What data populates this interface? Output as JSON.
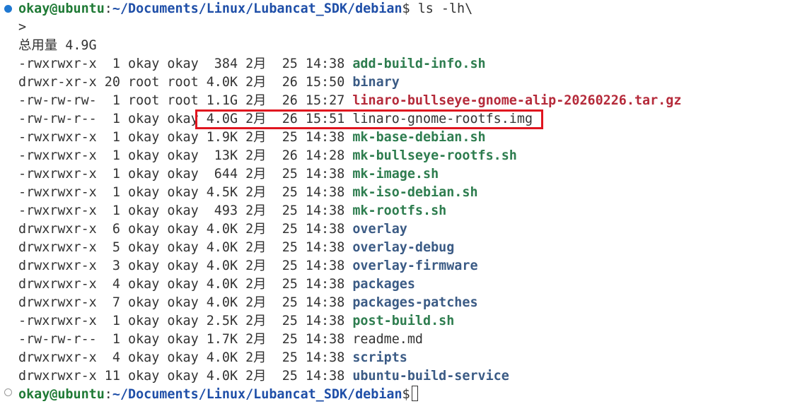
{
  "prompt": {
    "user_host": "okay@ubuntu",
    "colon": ":",
    "path": "~/Documents/Linux/Lubancat_SDK/debian",
    "symbol": "$",
    "command": " ls -lh\\"
  },
  "continuation": ">",
  "total_line": "总用量 4.9G",
  "listing": [
    {
      "meta": "-rwxrwxr-x  1 okay okay  384 2月  25 14:38 ",
      "name": "add-build-info.sh",
      "kind": "exec"
    },
    {
      "meta": "drwxr-xr-x 20 root root 4.0K 2月  26 15:50 ",
      "name": "binary",
      "kind": "dir"
    },
    {
      "meta": "-rw-rw-rw-  1 root root 1.1G 2月  26 15:27 ",
      "name": "linaro-bullseye-gnome-alip-20260226.tar.gz",
      "kind": "arch"
    },
    {
      "meta": "-rw-rw-r--  1 okay okay 4.0G 2月  26 15:51 ",
      "name": "linaro-gnome-rootfs.img",
      "kind": "plain"
    },
    {
      "meta": "-rwxrwxr-x  1 okay okay 1.9K 2月  25 14:38 ",
      "name": "mk-base-debian.sh",
      "kind": "exec"
    },
    {
      "meta": "-rwxrwxr-x  1 okay okay  13K 2月  26 14:28 ",
      "name": "mk-bullseye-rootfs.sh",
      "kind": "exec"
    },
    {
      "meta": "-rwxrwxr-x  1 okay okay  644 2月  25 14:38 ",
      "name": "mk-image.sh",
      "kind": "exec"
    },
    {
      "meta": "-rwxrwxr-x  1 okay okay 4.5K 2月  25 14:38 ",
      "name": "mk-iso-debian.sh",
      "kind": "exec"
    },
    {
      "meta": "-rwxrwxr-x  1 okay okay  493 2月  25 14:38 ",
      "name": "mk-rootfs.sh",
      "kind": "exec"
    },
    {
      "meta": "drwxrwxr-x  6 okay okay 4.0K 2月  25 14:38 ",
      "name": "overlay",
      "kind": "dir"
    },
    {
      "meta": "drwxrwxr-x  5 okay okay 4.0K 2月  25 14:38 ",
      "name": "overlay-debug",
      "kind": "dir"
    },
    {
      "meta": "drwxrwxr-x  3 okay okay 4.0K 2月  25 14:38 ",
      "name": "overlay-firmware",
      "kind": "dir"
    },
    {
      "meta": "drwxrwxr-x  4 okay okay 4.0K 2月  25 14:38 ",
      "name": "packages",
      "kind": "dir"
    },
    {
      "meta": "drwxrwxr-x  7 okay okay 4.0K 2月  25 14:38 ",
      "name": "packages-patches",
      "kind": "dir"
    },
    {
      "meta": "-rwxrwxr-x  1 okay okay 2.5K 2月  25 14:38 ",
      "name": "post-build.sh",
      "kind": "exec"
    },
    {
      "meta": "-rw-rw-r--  1 okay okay 1.7K 2月  25 14:38 ",
      "name": "readme.md",
      "kind": "plain"
    },
    {
      "meta": "drwxrwxr-x  4 okay okay 4.0K 2月  25 14:38 ",
      "name": "scripts",
      "kind": "dir"
    },
    {
      "meta": "drwxrwxr-x 11 okay okay 4.0K 2月  25 14:38 ",
      "name": "ubuntu-build-service",
      "kind": "dir"
    }
  ],
  "prompt2": {
    "user_host": "okay@ubuntu",
    "colon": ":",
    "path": "~/Documents/Linux/Lubancat_SDK/debian",
    "symbol": "$"
  },
  "colors": {
    "highlight_box": "#e0151f",
    "executable": "#2e7d4f",
    "directory": "#3b5b85",
    "archive": "#b52a3a"
  }
}
